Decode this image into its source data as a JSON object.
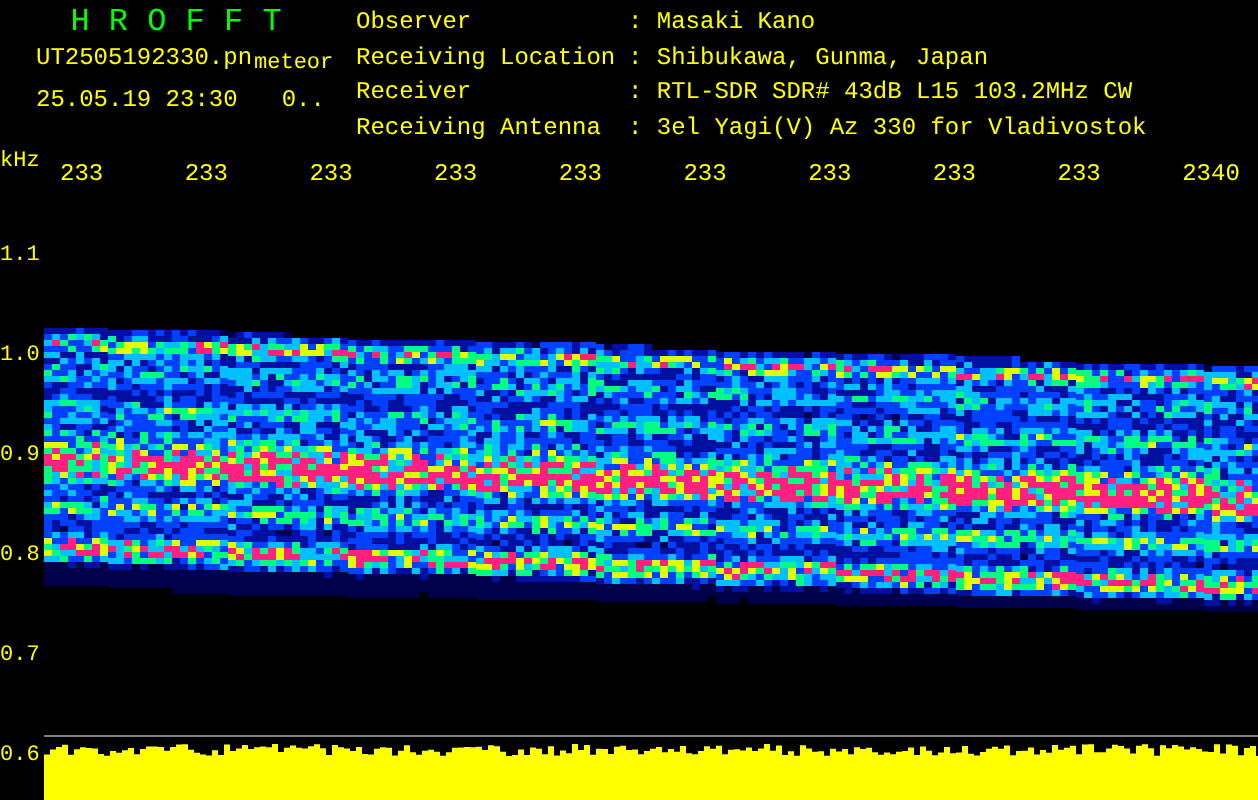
{
  "title": "H R O F F T",
  "file_name": "UT2505192330.pn",
  "tag": "meteor",
  "timestamp": "25.05.19 23:30",
  "counter": "0..",
  "info": [
    {
      "label": "Observer",
      "value": ": Masaki Kano"
    },
    {
      "label": "Receiving Location",
      "value": ": Shibukawa, Gunma, Japan"
    },
    {
      "label": "Receiver",
      "value": ": RTL-SDR SDR# 43dB L15 103.2MHz CW"
    },
    {
      "label": "Receiving Antenna",
      "value": ": 3el Yagi(V) Az 330 for Vladivostok"
    }
  ],
  "y_unit": "kHz",
  "x_ticks": [
    "233",
    "233",
    "233",
    "233",
    "233",
    "233",
    "233",
    "233",
    "233",
    "2340"
  ],
  "y_ticks": [
    "1.1",
    "1.0",
    "0.9",
    "0.8",
    "0.7",
    "0.6"
  ]
}
